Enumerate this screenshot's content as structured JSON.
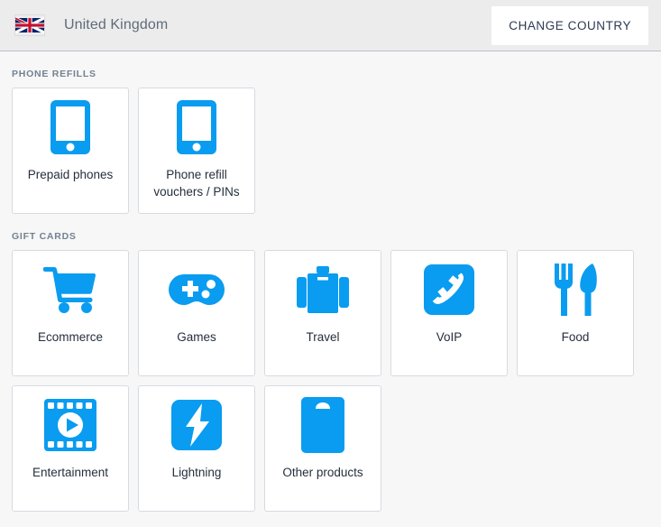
{
  "header": {
    "flag_icon": "uk-flag-icon",
    "country": "United Kingdom",
    "change_country_label": "CHANGE COUNTRY"
  },
  "theme": {
    "accent": "#099cf0",
    "page_bg": "#f7f7f8",
    "header_bg": "#ececec",
    "card_bg": "#ffffff",
    "card_border": "#d6dbe1",
    "section_label": "#72828f",
    "card_text": "#262f3d",
    "country_text": "#5f6b7a"
  },
  "sections": [
    {
      "title": "PHONE REFILLS",
      "cards": [
        {
          "label": "Prepaid phones",
          "icon": "smartphone-icon"
        },
        {
          "label": "Phone refill vouchers / PINs",
          "icon": "smartphone-icon"
        }
      ]
    },
    {
      "title": "GIFT CARDS",
      "cards": [
        {
          "label": "Ecommerce",
          "icon": "shopping-cart-icon"
        },
        {
          "label": "Games",
          "icon": "gamepad-icon"
        },
        {
          "label": "Travel",
          "icon": "suitcase-icon"
        },
        {
          "label": "VoIP",
          "icon": "phone-handset-icon"
        },
        {
          "label": "Food",
          "icon": "fork-knife-icon"
        },
        {
          "label": "Entertainment",
          "icon": "film-play-icon"
        },
        {
          "label": "Lightning",
          "icon": "lightning-bolt-icon"
        },
        {
          "label": "Other products",
          "icon": "gift-card-icon"
        }
      ]
    }
  ]
}
